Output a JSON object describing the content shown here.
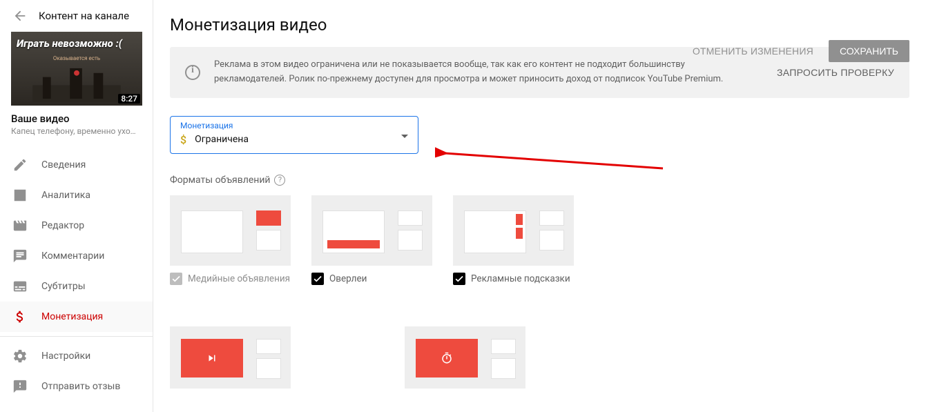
{
  "sidebar": {
    "back_label": "Контент на канале",
    "thumbnail_title": "Играть невозможно :(",
    "thumbnail_subtitle": "Оказывается есть",
    "duration": "8:27",
    "your_video_label": "Ваше видео",
    "video_title": "Капец телефону, временно ухожу ...",
    "items": [
      {
        "icon": "pencil-icon",
        "label": "Сведения"
      },
      {
        "icon": "analytics-icon",
        "label": "Аналитика"
      },
      {
        "icon": "editor-icon",
        "label": "Редактор"
      },
      {
        "icon": "comments-icon",
        "label": "Комментарии"
      },
      {
        "icon": "subtitles-icon",
        "label": "Субтитры"
      },
      {
        "icon": "dollar-icon",
        "label": "Монетизация"
      }
    ],
    "footer": [
      {
        "icon": "gear-icon",
        "label": "Настройки"
      },
      {
        "icon": "feedback-icon",
        "label": "Отправить отзыв"
      }
    ]
  },
  "main": {
    "title": "Монетизация видео",
    "actions": {
      "cancel": "ОТМЕНИТЬ ИЗМЕНЕНИЯ",
      "save": "СОХРАНИТЬ"
    },
    "alert": {
      "text": "Реклама в этом видео ограничена или не показывается вообще, так как его контент не подходит большинству рекламодателей. Ролик по-прежнему доступен для просмотра и может приносить доход от подписок YouTube Premium.",
      "button": "ЗАПРОСИТЬ ПРОВЕРКУ"
    },
    "select": {
      "label": "Монетизация",
      "value": "Ограничена"
    },
    "ad_formats_label": "Форматы объявлений",
    "formats": [
      {
        "id": "display",
        "label": "Медийные объявления",
        "checked": true,
        "disabled": true
      },
      {
        "id": "overlay",
        "label": "Оверлеи",
        "checked": true,
        "disabled": false
      },
      {
        "id": "sponsored",
        "label": "Рекламные подсказки",
        "checked": true,
        "disabled": false
      },
      {
        "id": "skippable",
        "label": "",
        "checked": true,
        "disabled": false
      },
      {
        "id": "nonskippable",
        "label": "",
        "checked": true,
        "disabled": false
      }
    ]
  },
  "colors": {
    "accent": "#1a73e8",
    "danger": "#cc0000",
    "ad_red": "#ee4b3e"
  }
}
